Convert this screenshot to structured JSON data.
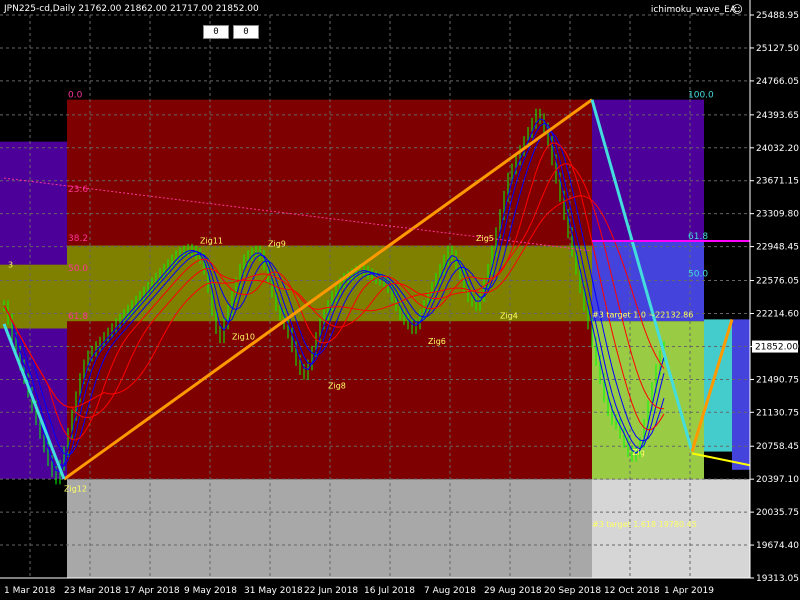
{
  "header": {
    "symbol_line": "JPN225-cd,Daily  21762.00 21862.00 21717.00 21852.00",
    "ea_name": "ichimoku_wave_EA",
    "buttons": [
      "0",
      "0"
    ]
  },
  "colors": {
    "background": "#000000",
    "grid": "#666666",
    "axis_text": "#ffffff",
    "price_box": "#ffffff",
    "fib_zone_dark_red": "#7f0000",
    "fib_zone_olive": "#7f7f00",
    "fib_zone_purple": "#4c0099",
    "fib_zone_gray": "#a8a8a8",
    "fib_zone_light_gray": "#d6d6d6",
    "fib_zone_green": "#99cc44",
    "fib_zone_blue": "#4444dd",
    "fib_zone_cyan": "#44cccc",
    "zigzag_orange": "#ff9900",
    "zigzag_cyan": "#44dddd",
    "ribbon_red": "#ff0000",
    "ribbon_blue": "#0000ff",
    "label_yellow": "#ffff66",
    "fib_text": "#ff3399",
    "magenta": "#ff00ff",
    "yellow_line": "#ffff00"
  },
  "chart_data": {
    "type": "candlestick",
    "title": "JPN225-cd,Daily",
    "yticks": [
      "25488.95",
      "25127.50",
      "24766.05",
      "24393.65",
      "24032.20",
      "23671.15",
      "23309.80",
      "22948.45",
      "22576.05",
      "22214.60",
      "21852.00",
      "21490.75",
      "21130.75",
      "20758.45",
      "20397.10",
      "20035.75",
      "19674.40",
      "19313.05"
    ],
    "ylim": [
      19313.05,
      25488.95
    ],
    "last_price": "21852.00",
    "xticks": [
      "1 Mar 2018",
      "23 Mar 2018",
      "17 Apr 2018",
      "9 May 2018",
      "31 May 2018",
      "22 Jun 2018",
      "16 Jul 2018",
      "7 Aug 2018",
      "29 Aug 2018",
      "20 Sep 2018",
      "12 Oct 2018",
      "1 Apr 2019"
    ],
    "fib_labels": [
      {
        "text": "0.0",
        "price": 24560
      },
      {
        "text": "23.6",
        "price": 23525
      },
      {
        "text": "38.2",
        "price": 22990
      },
      {
        "text": "50.0",
        "price": 22660
      },
      {
        "text": "61.8",
        "price": 22130
      }
    ],
    "right_fib_labels": [
      {
        "text": "100.0",
        "price": 24560
      },
      {
        "text": "61.8",
        "price": 23010
      },
      {
        "text": "50.0",
        "price": 22600
      }
    ],
    "zig_labels": [
      {
        "text": "Zig11",
        "day": 49,
        "price": 22980
      },
      {
        "text": "Zig9",
        "day": 66,
        "price": 22950
      },
      {
        "text": "Zig5",
        "day": 118,
        "price": 23010
      },
      {
        "text": "Zig10",
        "day": 57,
        "price": 21930
      },
      {
        "text": "Zig4",
        "day": 124,
        "price": 22160
      },
      {
        "text": "Zig8",
        "day": 81,
        "price": 21390
      },
      {
        "text": "Zig6",
        "day": 106,
        "price": 21880
      },
      {
        "text": "Zig12",
        "day": 15,
        "price": 20260
      },
      {
        "text": "Zig",
        "day": 157,
        "price": 20660
      }
    ],
    "annotations": [
      {
        "text": "3",
        "day": 1,
        "price": 22720
      },
      {
        "text": "#3 target 1.0 ~22132.86",
        "day": 147,
        "price": 22170
      },
      {
        "text": "#3 target 1.618 19780.45",
        "day": 147,
        "price": 19870
      }
    ],
    "closes": [
      22300,
      22150,
      21950,
      21800,
      21650,
      21500,
      21350,
      21200,
      21050,
      20900,
      20750,
      20600,
      20480,
      20400,
      20550,
      20700,
      20900,
      21100,
      21300,
      21500,
      21650,
      21750,
      21800,
      21850,
      21900,
      21950,
      22000,
      22050,
      22100,
      22150,
      22200,
      22250,
      22300,
      22350,
      22400,
      22450,
      22500,
      22550,
      22600,
      22650,
      22700,
      22750,
      22800,
      22850,
      22880,
      22900,
      22920,
      22900,
      22870,
      22820,
      22700,
      22500,
      22250,
      22050,
      21950,
      22100,
      22250,
      22400,
      22550,
      22700,
      22800,
      22850,
      22880,
      22900,
      22850,
      22750,
      22600,
      22450,
      22300,
      22200,
      22100,
      22000,
      21850,
      21700,
      21600,
      21550,
      21650,
      21800,
      21950,
      22100,
      22200,
      22300,
      22400,
      22480,
      22550,
      22600,
      22620,
      22650,
      22680,
      22700,
      22680,
      22650,
      22620,
      22600,
      22580,
      22550,
      22500,
      22400,
      22300,
      22200,
      22150,
      22100,
      22050,
      22100,
      22200,
      22300,
      22400,
      22500,
      22600,
      22700,
      22800,
      22900,
      22850,
      22750,
      22650,
      22500,
      22400,
      22350,
      22300,
      22400,
      22550,
      22700,
      22900,
      23100,
      23300,
      23500,
      23700,
      23800,
      23900,
      24000,
      24100,
      24200,
      24300,
      24400,
      24350,
      24250,
      24100,
      23900,
      23700,
      23500,
      23300,
      23100,
      22900,
      22700,
      22500,
      22300,
      22100,
      21900,
      21700,
      21500,
      21300,
      21150,
      21050,
      21000,
      20900,
      20800,
      20700,
      20650,
      20700,
      20800,
      21000,
      21200,
      21400,
      21600,
      21750,
      21852
    ]
  }
}
